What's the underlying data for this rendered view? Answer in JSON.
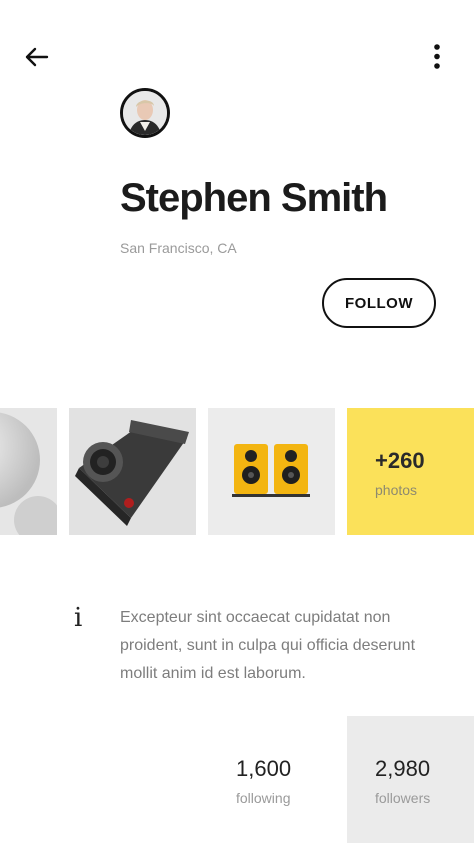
{
  "header": {
    "back_icon": "arrow-left-icon",
    "more_icon": "more-vertical-icon"
  },
  "profile": {
    "name": "Stephen Smith",
    "location": "San Francisco, CA",
    "follow_label": "FOLLOW"
  },
  "photos": {
    "items": [
      {
        "name": "sphere-speaker-photo"
      },
      {
        "name": "camera-photo"
      },
      {
        "name": "yellow-speakers-photo"
      }
    ],
    "more_count": "+260",
    "more_label": "photos"
  },
  "info": {
    "icon": "info-icon",
    "glyph": "i",
    "bio": "Excepteur sint occaecat cupidatat non proident, sunt in culpa qui officia deserunt mollit anim id est laborum."
  },
  "stats": {
    "following_value": "1,600",
    "following_label": "following",
    "followers_value": "2,980",
    "followers_label": "followers"
  },
  "colors": {
    "accent_yellow": "#FBE15A",
    "text_dark": "#1B1B1B",
    "text_muted": "#9A9A9A"
  }
}
